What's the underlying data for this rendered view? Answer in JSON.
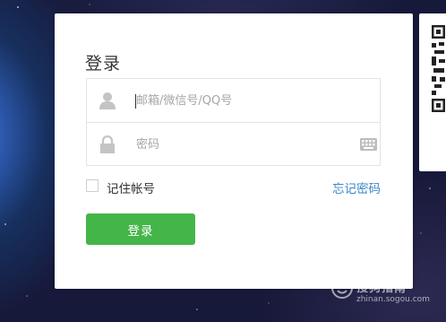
{
  "login": {
    "title": "登录",
    "account_placeholder": "邮箱/微信号/QQ号",
    "password_placeholder": "密码",
    "remember_label": "记住帐号",
    "remember_checked": false,
    "forgot_label": "忘记密码",
    "submit_label": "登录"
  },
  "icons": {
    "account": "user-icon",
    "password": "lock-icon",
    "keyboard": "keyboard-icon",
    "qr": "qr-code-icon"
  },
  "colors": {
    "primary_button": "#44b549",
    "link": "#3b87c8",
    "panel": "#ffffff"
  },
  "watermark": {
    "title": "搜狗指南",
    "url": "zhinan.sogou.com"
  }
}
